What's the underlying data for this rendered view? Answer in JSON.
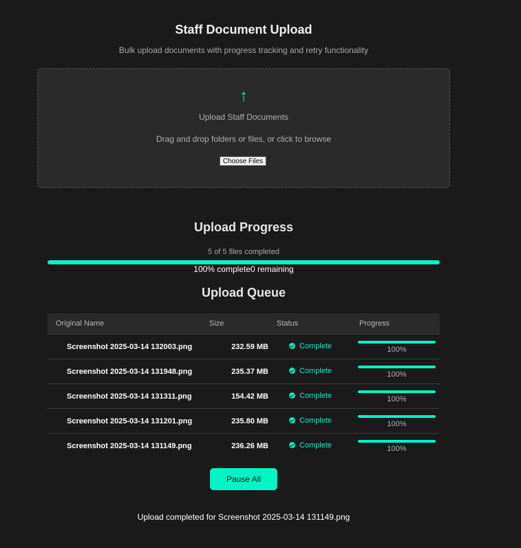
{
  "header": {
    "title": "Staff Document Upload",
    "subtitle": "Bulk upload documents with progress tracking and retry functionality"
  },
  "dropzone": {
    "icon": "upload-arrow-icon",
    "arrow_glyph": "↑",
    "title": "Upload Staff Documents",
    "hint": "Drag and drop folders or files, or click to browse",
    "button_label": "Choose Files"
  },
  "progress": {
    "title": "Upload Progress",
    "count_text": "5 of 5 files completed",
    "percent": 100,
    "stats_text": "100% complete0 remaining"
  },
  "queue": {
    "title": "Upload Queue",
    "columns": [
      "Original Name",
      "Size",
      "Status",
      "Progress"
    ],
    "rows": [
      {
        "name": "Screenshot 2025-03-14 132003.png",
        "size": "232.59 MB",
        "status": "Complete",
        "progress": 100,
        "progress_label": "100%"
      },
      {
        "name": "Screenshot 2025-03-14 131948.png",
        "size": "235.37 MB",
        "status": "Complete",
        "progress": 100,
        "progress_label": "100%"
      },
      {
        "name": "Screenshot 2025-03-14 131311.png",
        "size": "154.42 MB",
        "status": "Complete",
        "progress": 100,
        "progress_label": "100%"
      },
      {
        "name": "Screenshot 2025-03-14 131201.png",
        "size": "235.80 MB",
        "status": "Complete",
        "progress": 100,
        "progress_label": "100%"
      },
      {
        "name": "Screenshot 2025-03-14 131149.png",
        "size": "236.26 MB",
        "status": "Complete",
        "progress": 100,
        "progress_label": "100%"
      }
    ]
  },
  "actions": {
    "pause_label": "Pause All"
  },
  "footer": {
    "message": "Upload completed for Screenshot 2025-03-14 131149.png"
  },
  "colors": {
    "accent": "#00f5c4",
    "background": "#1a1a1a",
    "panel": "#2a2a2a"
  }
}
